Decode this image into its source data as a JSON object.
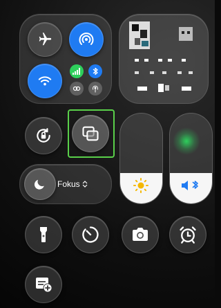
{
  "focus": {
    "label": "Fokus",
    "chevron": "⌃⌄"
  },
  "toggles": {
    "airplane": {
      "icon": "airplane-icon",
      "state": "off"
    },
    "airdrop": {
      "icon": "airdrop-icon",
      "state": "on"
    },
    "wifi": {
      "icon": "wifi-icon",
      "state": "on"
    },
    "cellular": {
      "icon": "cellular-icon",
      "state": "on"
    },
    "bluetooth": {
      "icon": "bluetooth-icon",
      "state": "on"
    },
    "link": {
      "icon": "link-icon",
      "state": "off"
    },
    "hotspot": {
      "icon": "hotspot-icon",
      "state": "off"
    }
  },
  "brightness": {
    "icon": "sun-icon",
    "level": 0.34
  },
  "volume": {
    "icon": "speaker-bluetooth-icon",
    "level": 0.34
  },
  "colors": {
    "blue": "#1f7bf2",
    "green": "#2ecf5c",
    "highlight": "#5ad14a"
  },
  "buttons": [
    "flashlight-icon",
    "timer-icon",
    "camera-icon",
    "alarm-icon",
    "add-note-icon",
    "orientation-lock-icon",
    "screen-mirroring-icon",
    "moon-icon"
  ]
}
